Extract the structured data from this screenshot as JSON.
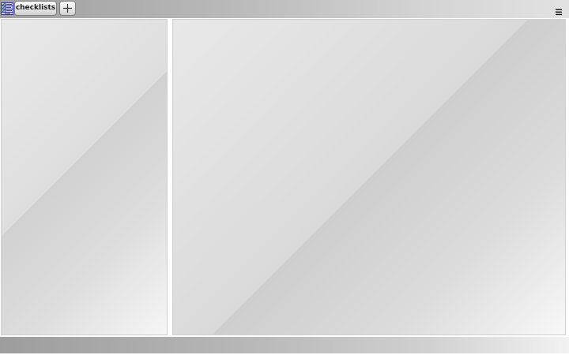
{
  "header": {
    "app_icon": "checklist-app-icon",
    "tabs": [
      {
        "label": "checklists",
        "active": true
      }
    ],
    "add_tab_icon": "plus-icon",
    "menu_icon": "hamburger-menu-icon"
  },
  "panels": {
    "left": {
      "empty": true
    },
    "right": {
      "empty": true
    }
  },
  "colors": {
    "toolbar_dark": "#9f9f9f",
    "toolbar_light": "#e2e2e2",
    "panel_bg": "#dedede",
    "border": "#cfcfcf"
  }
}
